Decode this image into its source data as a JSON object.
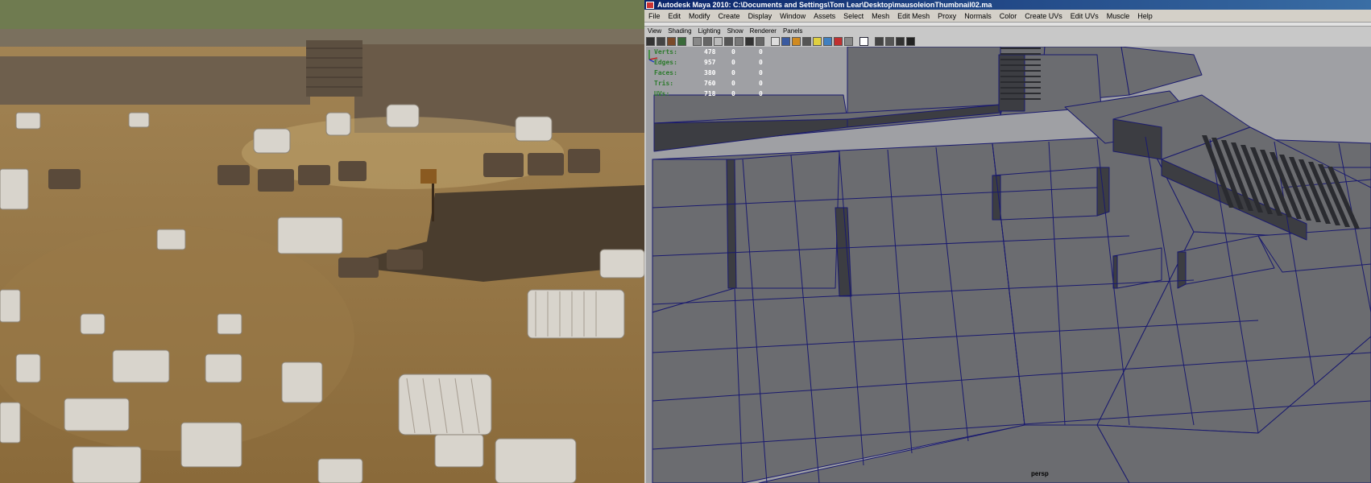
{
  "window": {
    "title": "Autodesk Maya 2010: C:\\Documents and Settings\\Tom Lear\\Desktop\\mausoleionThumbnail02.ma"
  },
  "menubar": {
    "items": [
      "File",
      "Edit",
      "Modify",
      "Create",
      "Display",
      "Window",
      "Assets",
      "Select",
      "Mesh",
      "Edit Mesh",
      "Proxy",
      "Normals",
      "Color",
      "Create UVs",
      "Edit UVs",
      "Muscle",
      "Help"
    ]
  },
  "panel_menu": {
    "items": [
      "View",
      "Shading",
      "Lighting",
      "Show",
      "Renderer",
      "Panels"
    ]
  },
  "toolbar": {
    "icons": [
      "select-camera-icon",
      "lock-camera-icon",
      "camera-attributes-icon",
      "bookmark-icon",
      "image-plane-icon",
      "grid-icon",
      "film-gate-icon",
      "resolution-gate-icon",
      "gate-mask-icon",
      "field-chart-icon",
      "safe-action-icon",
      "wireframe-icon",
      "smooth-shade-icon",
      "flat-shade-icon",
      "bounding-box-icon",
      "default-light-icon",
      "textured-icon",
      "shadows-icon",
      "high-quality-icon",
      "isolate-select-icon",
      "xray-icon",
      "xray-joints-icon",
      "backface-icon",
      "frame-all-icon"
    ]
  },
  "hud": {
    "rows": [
      {
        "label": "Verts:",
        "v1": "478",
        "v2": "0",
        "v3": "0"
      },
      {
        "label": "Edges:",
        "v1": "957",
        "v2": "0",
        "v3": "0"
      },
      {
        "label": "Faces:",
        "v1": "380",
        "v2": "0",
        "v3": "0"
      },
      {
        "label": "Tris:",
        "v1": "760",
        "v2": "0",
        "v3": "0"
      },
      {
        "label": "UVs:",
        "v1": "718",
        "v2": "0",
        "v3": "0"
      }
    ]
  },
  "viewport": {
    "camera_label": "persp",
    "mesh_color": "#6b6c70",
    "edge_color": "#1a1a6e",
    "background_color": "#9fa0a4"
  }
}
